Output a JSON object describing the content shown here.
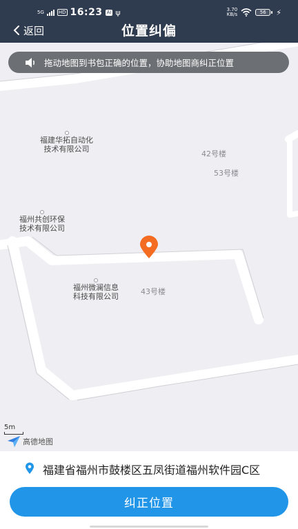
{
  "status_bar": {
    "network": "5G",
    "hd": "HD",
    "time": "16:23",
    "badge": "Ai",
    "speed_value": "3.70",
    "speed_unit": "KB/s",
    "battery": "56"
  },
  "header": {
    "back_label": "返回",
    "title": "位置纠偏"
  },
  "map": {
    "notice": "拖动地图到书包正确的位置，协助地图商纠正位置",
    "pois": [
      {
        "line1": "福建华拓自动化",
        "line2": "技术有限公司"
      },
      {
        "line1": "福州共创环保",
        "line2": "技术有限公司"
      },
      {
        "line1": "福州微澜信息",
        "line2": "科技有限公司"
      }
    ],
    "buildings": [
      "42号楼",
      "53号楼",
      "43号楼"
    ],
    "scale_label": "5m",
    "logo_text": "高德地图",
    "pin_color": "#f36c21"
  },
  "address": {
    "text": "福建省福州市鼓楼区五凤街道福州软件园C区",
    "icon_color": "#2196e9"
  },
  "confirm_button": {
    "label": "纠正位置",
    "color": "#2196e9"
  },
  "colors": {
    "header_bg": "#2f3b4e",
    "map_bg": "#efeff3",
    "road": "#ffffff"
  }
}
